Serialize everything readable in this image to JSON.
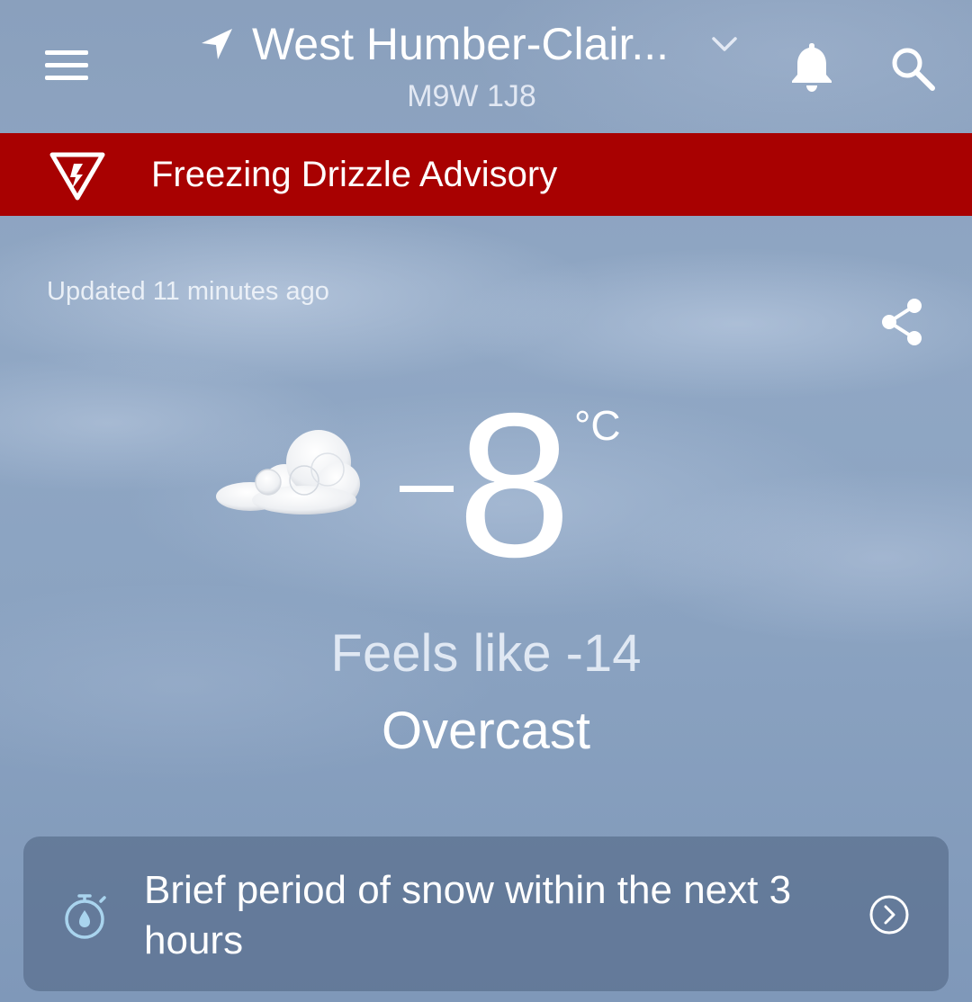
{
  "header": {
    "location_name": "West Humber-Clair...",
    "postal_code": "M9W 1J8",
    "menu_icon": "hamburger-menu-icon",
    "location_icon": "navigation-arrow-icon",
    "dropdown_icon": "chevron-down-icon",
    "bell_icon": "bell-icon",
    "search_icon": "search-icon"
  },
  "alert": {
    "text": "Freezing Drizzle Advisory",
    "icon": "warning-triangle-icon",
    "color": "#a80101"
  },
  "updated": "Updated 11 minutes ago",
  "share_icon": "share-icon",
  "current": {
    "icon": "cloud-icon",
    "temperature": "8",
    "unit": "°C",
    "feels_like": "Feels like -14",
    "condition": "Overcast"
  },
  "nowcast": {
    "message": "Brief period of snow within the next 3 hours",
    "icon": "stopwatch-droplet-icon",
    "arrow_icon": "chevron-right-circle-icon"
  }
}
